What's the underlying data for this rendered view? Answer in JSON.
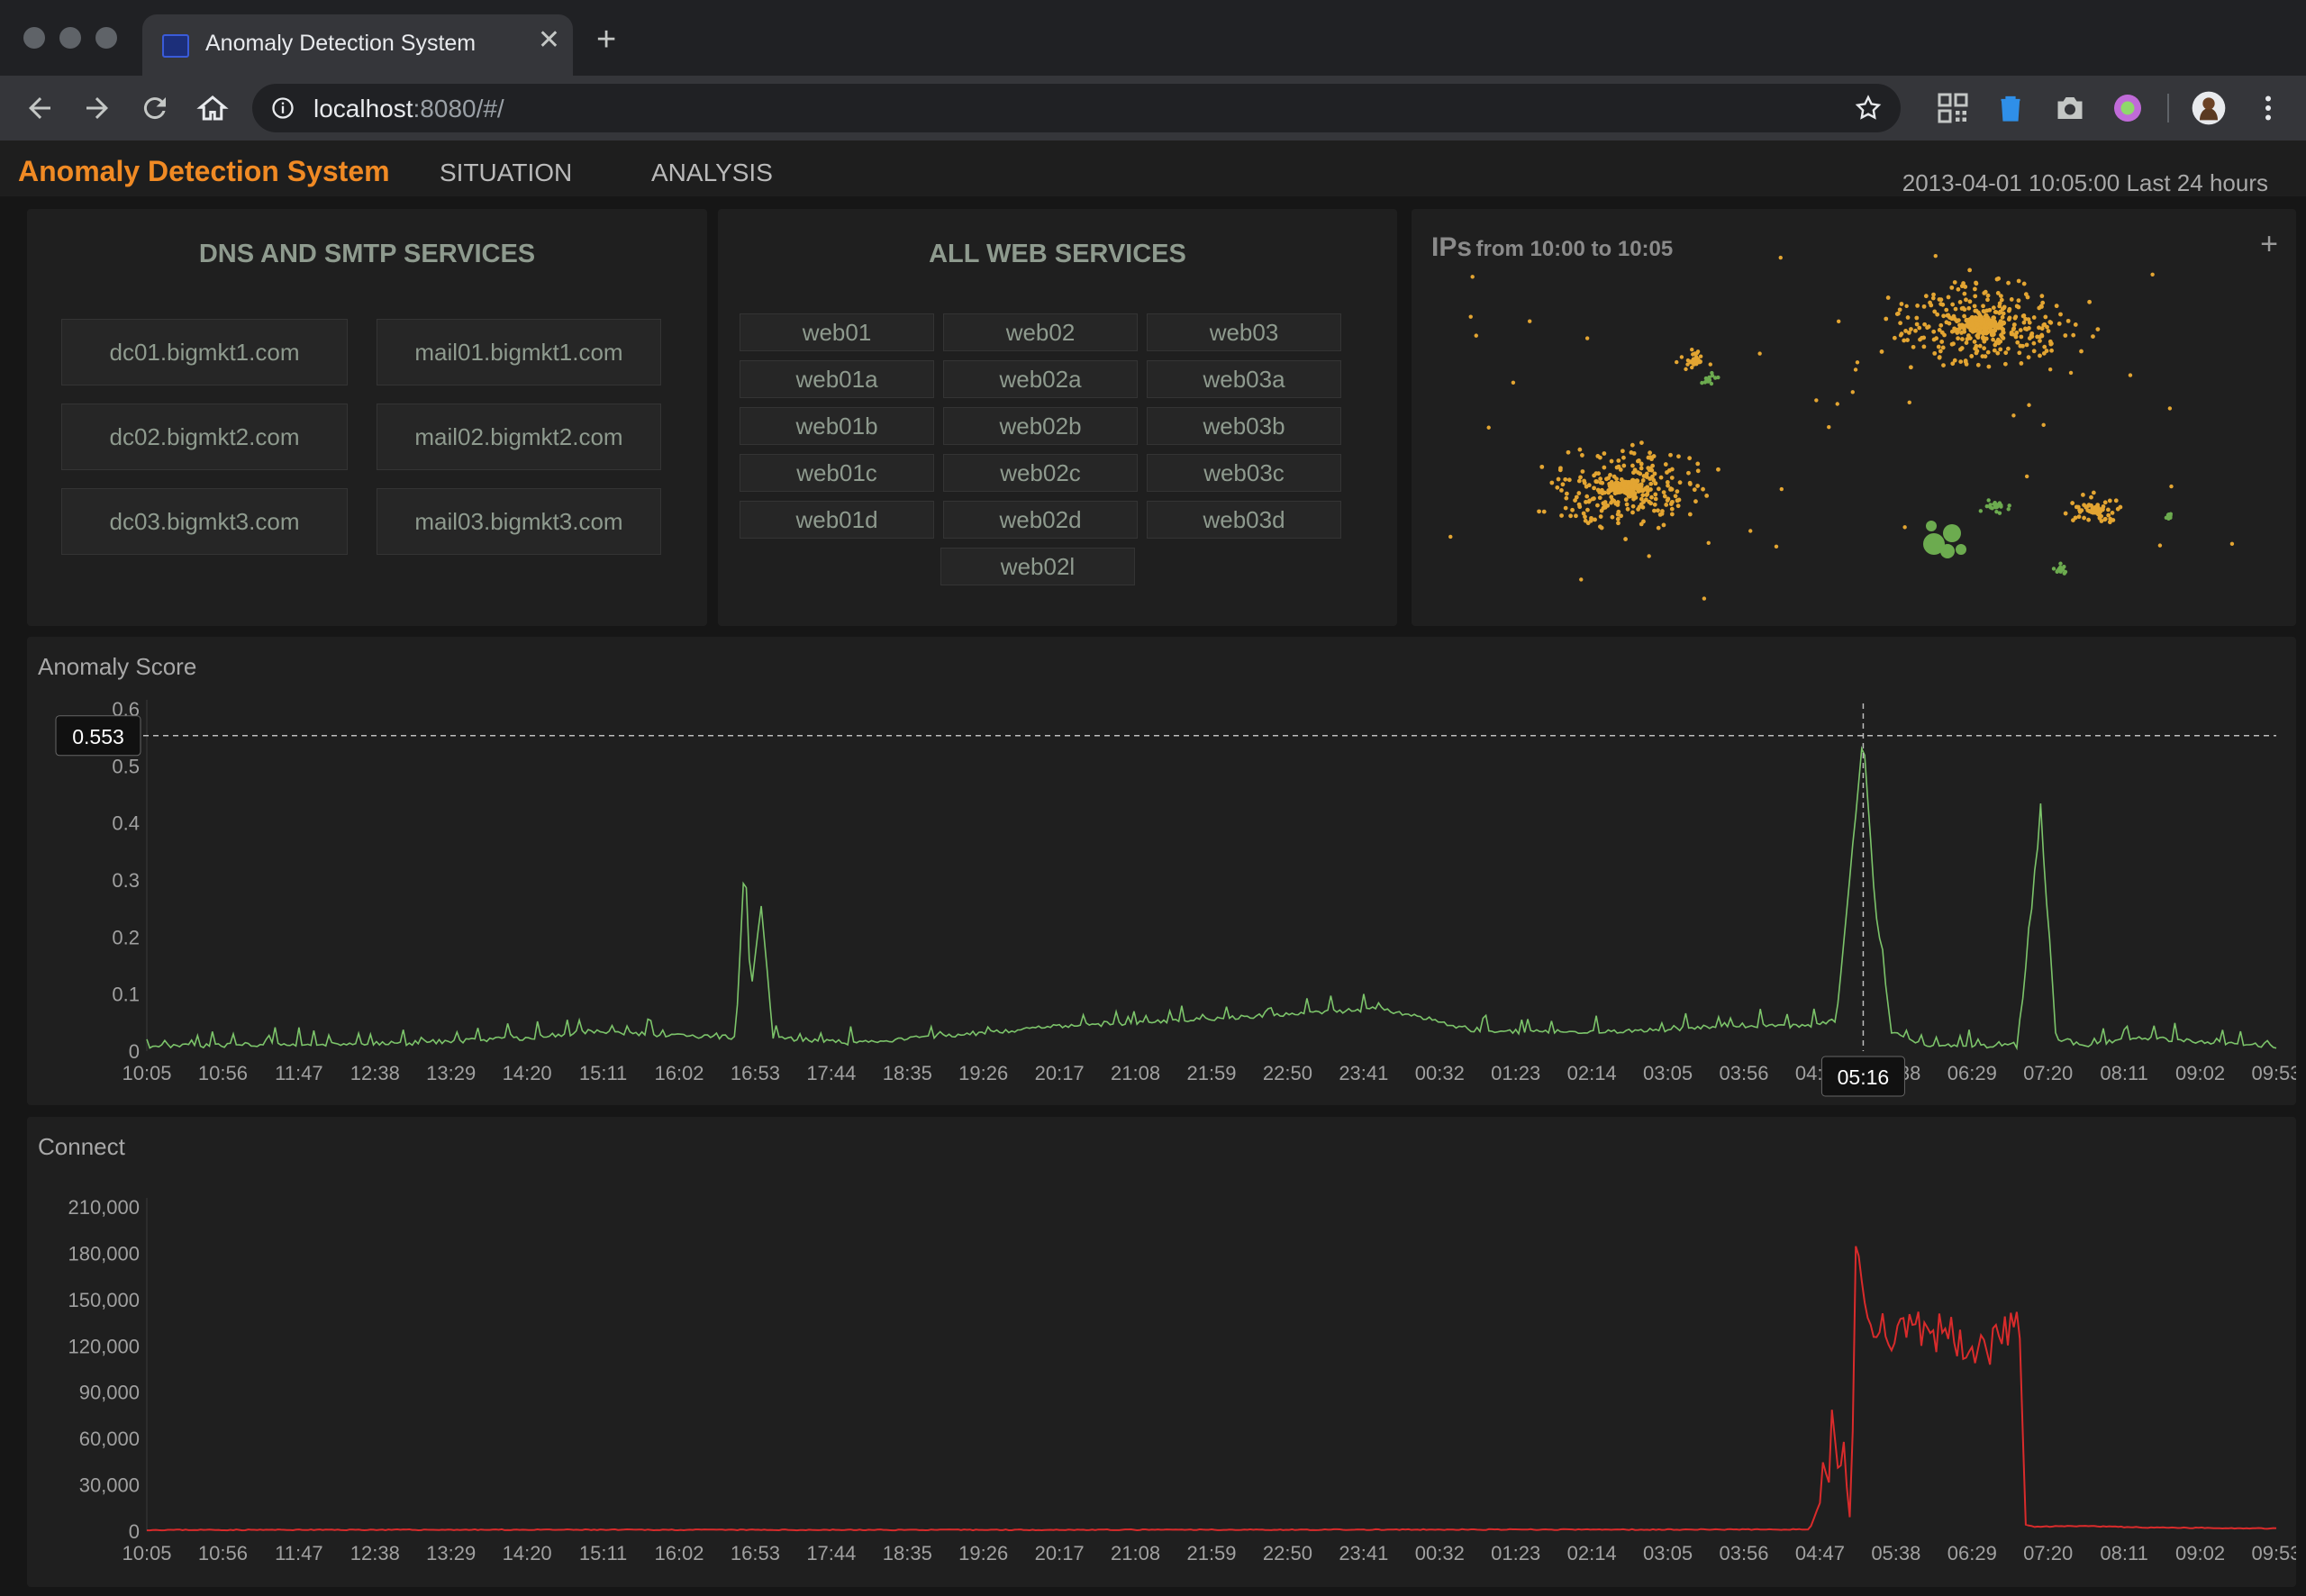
{
  "browser": {
    "tab_title": "Anomaly Detection System",
    "url_host": "localhost",
    "url_rest": ":8080/#/"
  },
  "app": {
    "brand": "Anomaly Detection System",
    "nav": [
      "SITUATION",
      "ANALYSIS"
    ],
    "datetime": "2013-04-01 10:05:00",
    "range": "Last 24 hours",
    "accent": "#f08a24"
  },
  "dns_panel": {
    "title": "DNS AND SMTP SERVICES",
    "services": [
      "dc01.bigmkt1.com",
      "mail01.bigmkt1.com",
      "dc02.bigmkt2.com",
      "mail02.bigmkt2.com",
      "dc03.bigmkt3.com",
      "mail03.bigmkt3.com"
    ]
  },
  "web_panel": {
    "title": "ALL WEB SERVICES",
    "services": [
      "web01",
      "web02",
      "web03",
      "web01a",
      "web02a",
      "web03a",
      "web01b",
      "web02b",
      "web03b",
      "web01c",
      "web02c",
      "web03c",
      "web01d",
      "web02d",
      "web03d",
      "web02l"
    ]
  },
  "ips_panel": {
    "title": "IPs",
    "subtitle": "from 10:00 to 10:05",
    "plus": "+",
    "colors": {
      "cluster": "#e3a532",
      "minority": "#6cab4f"
    }
  },
  "chart_data": [
    {
      "type": "line",
      "title": "Anomaly Score",
      "color": "#7cc46a",
      "x_ticks": [
        "10:05",
        "10:56",
        "11:47",
        "12:38",
        "13:29",
        "14:20",
        "15:11",
        "16:02",
        "16:53",
        "17:44",
        "18:35",
        "19:26",
        "20:17",
        "21:08",
        "21:59",
        "22:50",
        "23:41",
        "00:32",
        "01:23",
        "02:14",
        "03:05",
        "03:56",
        "04:47",
        "05:38",
        "06:29",
        "07:20",
        "08:11",
        "09:02",
        "09:53"
      ],
      "y_ticks": [
        "0",
        "0.1",
        "0.2",
        "0.3",
        "0.4",
        "0.5",
        "0.6"
      ],
      "ylim": [
        0,
        0.6
      ],
      "x": [
        "10:05",
        "13:00",
        "14:25",
        "15:00",
        "16:40",
        "16:46",
        "16:50",
        "16:57",
        "17:05",
        "18:00",
        "20:20",
        "21:40",
        "22:45",
        "23:52",
        "01:00",
        "02:30",
        "03:50",
        "04:40",
        "04:58",
        "05:16",
        "05:24",
        "05:35",
        "06:00",
        "07:00",
        "07:15",
        "07:25",
        "07:45",
        "08:20",
        "09:53"
      ],
      "values": [
        0.005,
        0.01,
        0.02,
        0.03,
        0.02,
        0.34,
        0.1,
        0.25,
        0.02,
        0.01,
        0.04,
        0.05,
        0.06,
        0.07,
        0.03,
        0.03,
        0.04,
        0.04,
        0.05,
        0.553,
        0.25,
        0.03,
        0.005,
        0.005,
        0.41,
        0.02,
        0.005,
        0.02,
        0.005
      ],
      "tooltip": {
        "value": "0.553",
        "time": "05:16"
      }
    },
    {
      "type": "line",
      "title": "Connect",
      "color": "#d92b2b",
      "x_ticks": [
        "10:05",
        "10:56",
        "11:47",
        "12:38",
        "13:29",
        "14:20",
        "15:11",
        "16:02",
        "16:53",
        "17:44",
        "18:35",
        "19:26",
        "20:17",
        "21:08",
        "21:59",
        "22:50",
        "23:41",
        "00:32",
        "01:23",
        "02:14",
        "03:05",
        "03:56",
        "04:47",
        "05:38",
        "06:29",
        "07:20",
        "08:11",
        "09:02",
        "09:53"
      ],
      "y_ticks": [
        "0",
        "30,000",
        "60,000",
        "90,000",
        "120,000",
        "150,000",
        "180,000",
        "210,000"
      ],
      "ylim": [
        0,
        210000
      ],
      "x": [
        "10:05",
        "14:00",
        "18:00",
        "22:00",
        "02:00",
        "04:40",
        "04:52",
        "04:58",
        "05:08",
        "05:10",
        "05:20",
        "05:40",
        "06:00",
        "06:40",
        "07:00",
        "07:05",
        "07:10",
        "07:40",
        "08:30",
        "09:53"
      ],
      "values": [
        500,
        600,
        500,
        600,
        700,
        800,
        30000,
        70000,
        2000,
        180000,
        140000,
        125000,
        130000,
        120000,
        140000,
        4000,
        2500,
        3000,
        2000,
        1500
      ]
    }
  ]
}
